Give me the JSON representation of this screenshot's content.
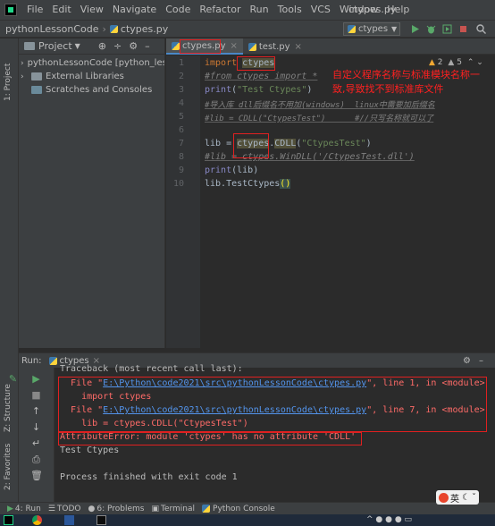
{
  "window": {
    "menu": [
      "File",
      "Edit",
      "View",
      "Navigate",
      "Code",
      "Refactor",
      "Run",
      "Tools",
      "VCS",
      "Window",
      "Help"
    ],
    "title": "ctypes.py"
  },
  "navbar": {
    "project": "pythonLessonCode",
    "file": "ctypes.py",
    "run_config": "ctypes"
  },
  "left_stripe": {
    "project_label": "1: Project",
    "structure_label": "Z: Structure",
    "favorites_label": "2: Favorites"
  },
  "project_panel": {
    "header": "Project",
    "items": [
      {
        "label": "pythonLessonCode [python_less"
      },
      {
        "label": "External Libraries"
      },
      {
        "label": "Scratches and Consoles"
      }
    ]
  },
  "tabs": [
    {
      "label": "ctypes.py",
      "active": true
    },
    {
      "label": "test.py",
      "active": false
    }
  ],
  "editor": {
    "inspection": {
      "warnings": "2",
      "weak": "5"
    },
    "lines": [
      {
        "n": "1",
        "text": "import ctypes"
      },
      {
        "n": "2",
        "text": "#from ctypes import *"
      },
      {
        "n": "3",
        "text": "print(\"Test Ctypes\")"
      },
      {
        "n": "4",
        "text": "#导入库 dll后缀名不用加(windows)  linux中需要加后缀名"
      },
      {
        "n": "5",
        "text": "#lib = CDLL(\"CtypesTest\")      #//只写名称就可以了"
      },
      {
        "n": "6",
        "text": ""
      },
      {
        "n": "7",
        "text": "lib = ctypes.CDLL(\"CtypesTest\")"
      },
      {
        "n": "8",
        "text": "#lib = ctypes.WinDLL('/CtypesTest.dll')"
      },
      {
        "n": "9",
        "text": "print(lib)"
      },
      {
        "n": "10",
        "text": "lib.TestCtypes()"
      }
    ],
    "annotation_line1": "自定义程序名称与标准模块名称一",
    "annotation_line2": "致,导致找不到标准库文件"
  },
  "run_panel": {
    "label": "Run:",
    "config": "ctypes",
    "output": {
      "traceback": "Traceback (most recent call last):",
      "file1_prefix": "  File \"",
      "file1_path": "E:\\Python\\code2021\\src\\pythonLessonCode\\ctypes.py",
      "file1_suffix": "\", line 1, in <module>",
      "code1": "    import ctypes",
      "file2_prefix": "  File \"",
      "file2_path": "E:\\Python\\code2021\\src\\pythonLessonCode\\ctypes.py",
      "file2_suffix": "\", line 7, in <module>",
      "code2": "    lib = ctypes.CDLL(\"CtypesTest\")",
      "error": "AttributeError: module 'ctypes' has no attribute 'CDLL'",
      "stdout": "Test Ctypes",
      "finished": "Process finished with exit code 1"
    }
  },
  "bottom_bar": {
    "run": "4: Run",
    "todo": "TODO",
    "problems": "6: Problems",
    "terminal": "Terminal",
    "console": "Python Console"
  },
  "ime": {
    "label": "英"
  },
  "colors": {
    "error": "#ff6b68",
    "annotation": "#ff2020",
    "keyword": "#cc7832",
    "string": "#6a8759"
  }
}
